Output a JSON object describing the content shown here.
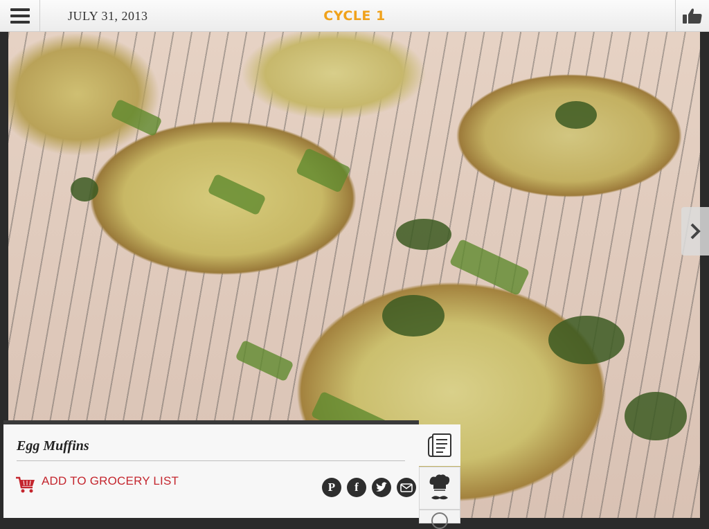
{
  "header": {
    "menu_icon": "hamburger-menu-icon",
    "date": "JULY 31, 2013",
    "cycle_title": "CYCLE 1",
    "like_icon": "thumbs-up-icon"
  },
  "photo": {
    "subject": "egg-muffins-photo",
    "next_icon": "chevron-right-icon"
  },
  "recipe": {
    "title": "Egg Muffins",
    "grocery_label": "ADD TO GROCERY LIST",
    "grocery_icon": "shopping-cart-icon",
    "share_icons": [
      "pinterest-icon",
      "facebook-icon",
      "twitter-icon",
      "email-icon"
    ]
  },
  "side": {
    "icons": [
      "recipe-card-icon",
      "chef-icon",
      "more-icon"
    ]
  },
  "colors": {
    "accent": "#f0a21b",
    "grocery_red": "#c4262e",
    "share_dark": "#2e2e2e"
  }
}
